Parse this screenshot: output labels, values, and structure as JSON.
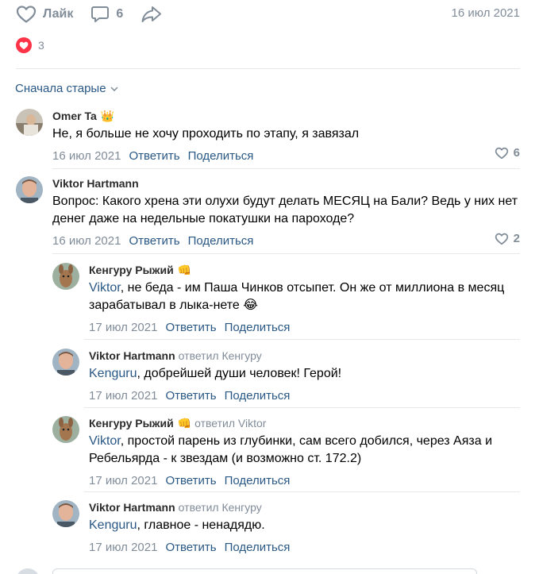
{
  "post": {
    "like_label": "Лайк",
    "comments_count": "6",
    "date": "16 июл 2021",
    "reactions_count": "3"
  },
  "sort_label": "Сначала старые",
  "comments": [
    {
      "author": "Omer Ta",
      "badge": "👑",
      "text": "Не, я больше не хочу проходить по этапу, я завязал",
      "date": "16 июл 2021",
      "reply": "Ответить",
      "share": "Поделиться",
      "likes": "6"
    },
    {
      "author": "Viktor Hartmann",
      "text": "Вопрос: Какого хрена эти олухи будут делать МЕСЯЦ на Бали? Ведь у них нет денег даже на недельные покатушки на пароходе?",
      "date": "16 июл 2021",
      "reply": "Ответить",
      "share": "Поделиться",
      "likes": "2"
    }
  ],
  "replies": [
    {
      "author": "Кенгуру Рыжий",
      "badge": "👊",
      "mention": "Viktor",
      "text": ", не беда - им Паша Чинков отсыпет. Он же от миллиона в месяц зарабатывал в лыка-нете 😂",
      "date": "17 июл 2021",
      "reply": "Ответить",
      "share": "Поделиться"
    },
    {
      "author": "Viktor Hartmann",
      "reply_note": "ответил Кенгуру",
      "mention": "Kenguru",
      "text": ", добрейшей души человек! Герой!",
      "date": "17 июл 2021",
      "reply": "Ответить",
      "share": "Поделиться"
    },
    {
      "author": "Кенгуру Рыжий",
      "badge": "👊",
      "reply_note": "ответил Viktor",
      "mention": "Viktor",
      "text": ", простой парень из глубинки, сам всего добился, через Аяза и Ребельярда - к звездам (и возможно ст. 172.2)",
      "date": "17 июл 2021",
      "reply": "Ответить",
      "share": "Поделиться"
    },
    {
      "author": "Viktor Hartmann",
      "reply_note": "ответил Кенгуру",
      "mention": "Kenguru",
      "text": ", главное - ненадядю.",
      "date": "17 июл 2021",
      "reply": "Ответить",
      "share": "Поделиться"
    }
  ],
  "colors": {
    "link": "#2a5885",
    "muted": "#818c99",
    "heart": "#ff3347",
    "divider": "#e7e8ec"
  }
}
